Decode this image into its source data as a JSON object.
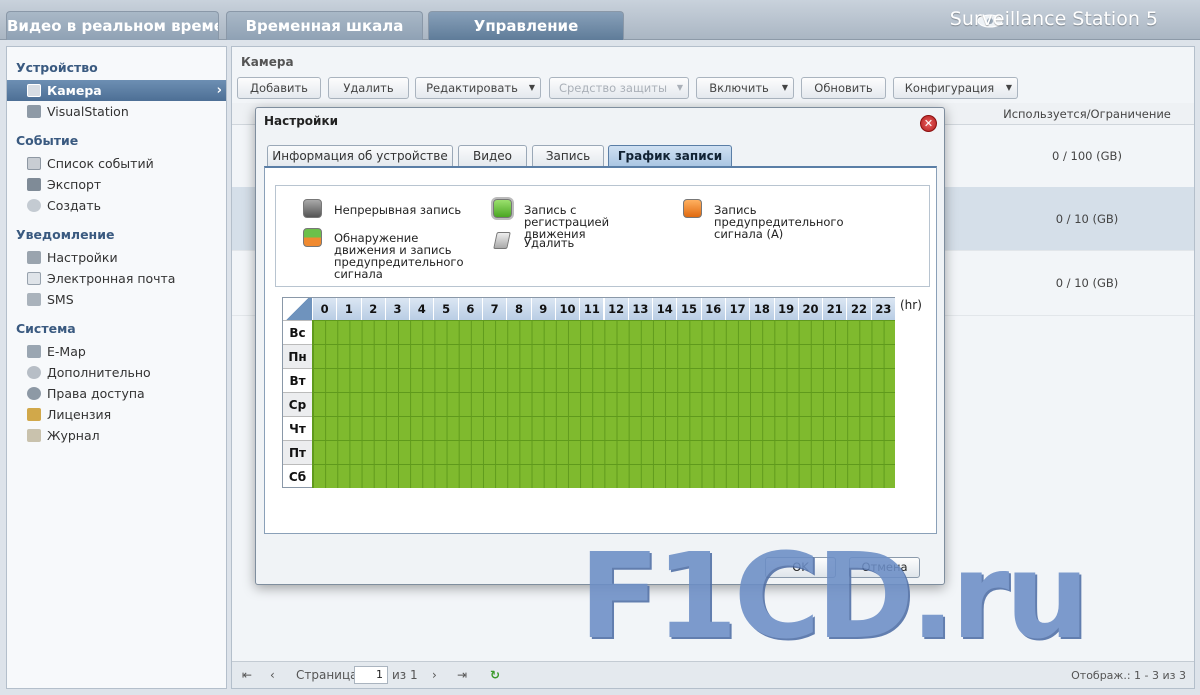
{
  "app": {
    "tabs": [
      "Видео в реальном времени",
      "Временная шкала",
      "Управление"
    ],
    "brand": "Surveillance Station 5"
  },
  "sidebar": {
    "sections": [
      {
        "title": "Устройство",
        "items": [
          "Камера",
          "VisualStation"
        ]
      },
      {
        "title": "Событие",
        "items": [
          "Список событий",
          "Экспорт",
          "Создать"
        ]
      },
      {
        "title": "Уведомление",
        "items": [
          "Настройки",
          "Электронная почта",
          "SMS"
        ]
      },
      {
        "title": "Система",
        "items": [
          "E-Map",
          "Дополнительно",
          "Права доступа",
          "Лицензия",
          "Журнал"
        ]
      }
    ]
  },
  "main": {
    "title": "Камера",
    "toolbar": {
      "add": "Добавить",
      "delete": "Удалить",
      "edit": "Редактировать",
      "protect": "Средство защиты",
      "enable": "Включить",
      "refresh": "Обновить",
      "config": "Конфигурация"
    },
    "columns": {
      "usage": "Используется/Ограничение"
    },
    "rows": [
      {
        "usage": "0 / 100 (GB)"
      },
      {
        "usage": "0 / 10 (GB)"
      },
      {
        "usage": "0 / 10 (GB)"
      }
    ],
    "pager": {
      "page_label": "Страница",
      "page_value": "1",
      "of": "из 1",
      "display": "Отображ.: 1 - 3 из 3"
    }
  },
  "dialog": {
    "title": "Настройки",
    "tabs": [
      "Информация об устройстве",
      "Видео",
      "Запись",
      "График записи"
    ],
    "legend": {
      "continuous": "Непрерывная запись",
      "motion": "Запись с регистрацией движения",
      "alarm": "Запись предупредительного сигнала (A)",
      "motion_alarm": "Обнаружение движения и запись предупредительного сигнала",
      "erase": "Удалить"
    },
    "schedule": {
      "hours": [
        "0",
        "1",
        "2",
        "3",
        "4",
        "5",
        "6",
        "7",
        "8",
        "9",
        "10",
        "11",
        "12",
        "13",
        "14",
        "15",
        "16",
        "17",
        "18",
        "19",
        "20",
        "21",
        "22",
        "23"
      ],
      "unit": "(hr)",
      "days": [
        "Вс",
        "Пн",
        "Вт",
        "Ср",
        "Чт",
        "Пт",
        "Сб"
      ],
      "fill_color": "#7fba2e",
      "mode": "Запись с регистрацией движения"
    },
    "ok": "OK",
    "cancel": "Отмена"
  },
  "watermark": "F1CD.ru",
  "colors": {
    "motion": "#6cc04a",
    "alarm": "#f08a30",
    "continuous": "#777777"
  }
}
